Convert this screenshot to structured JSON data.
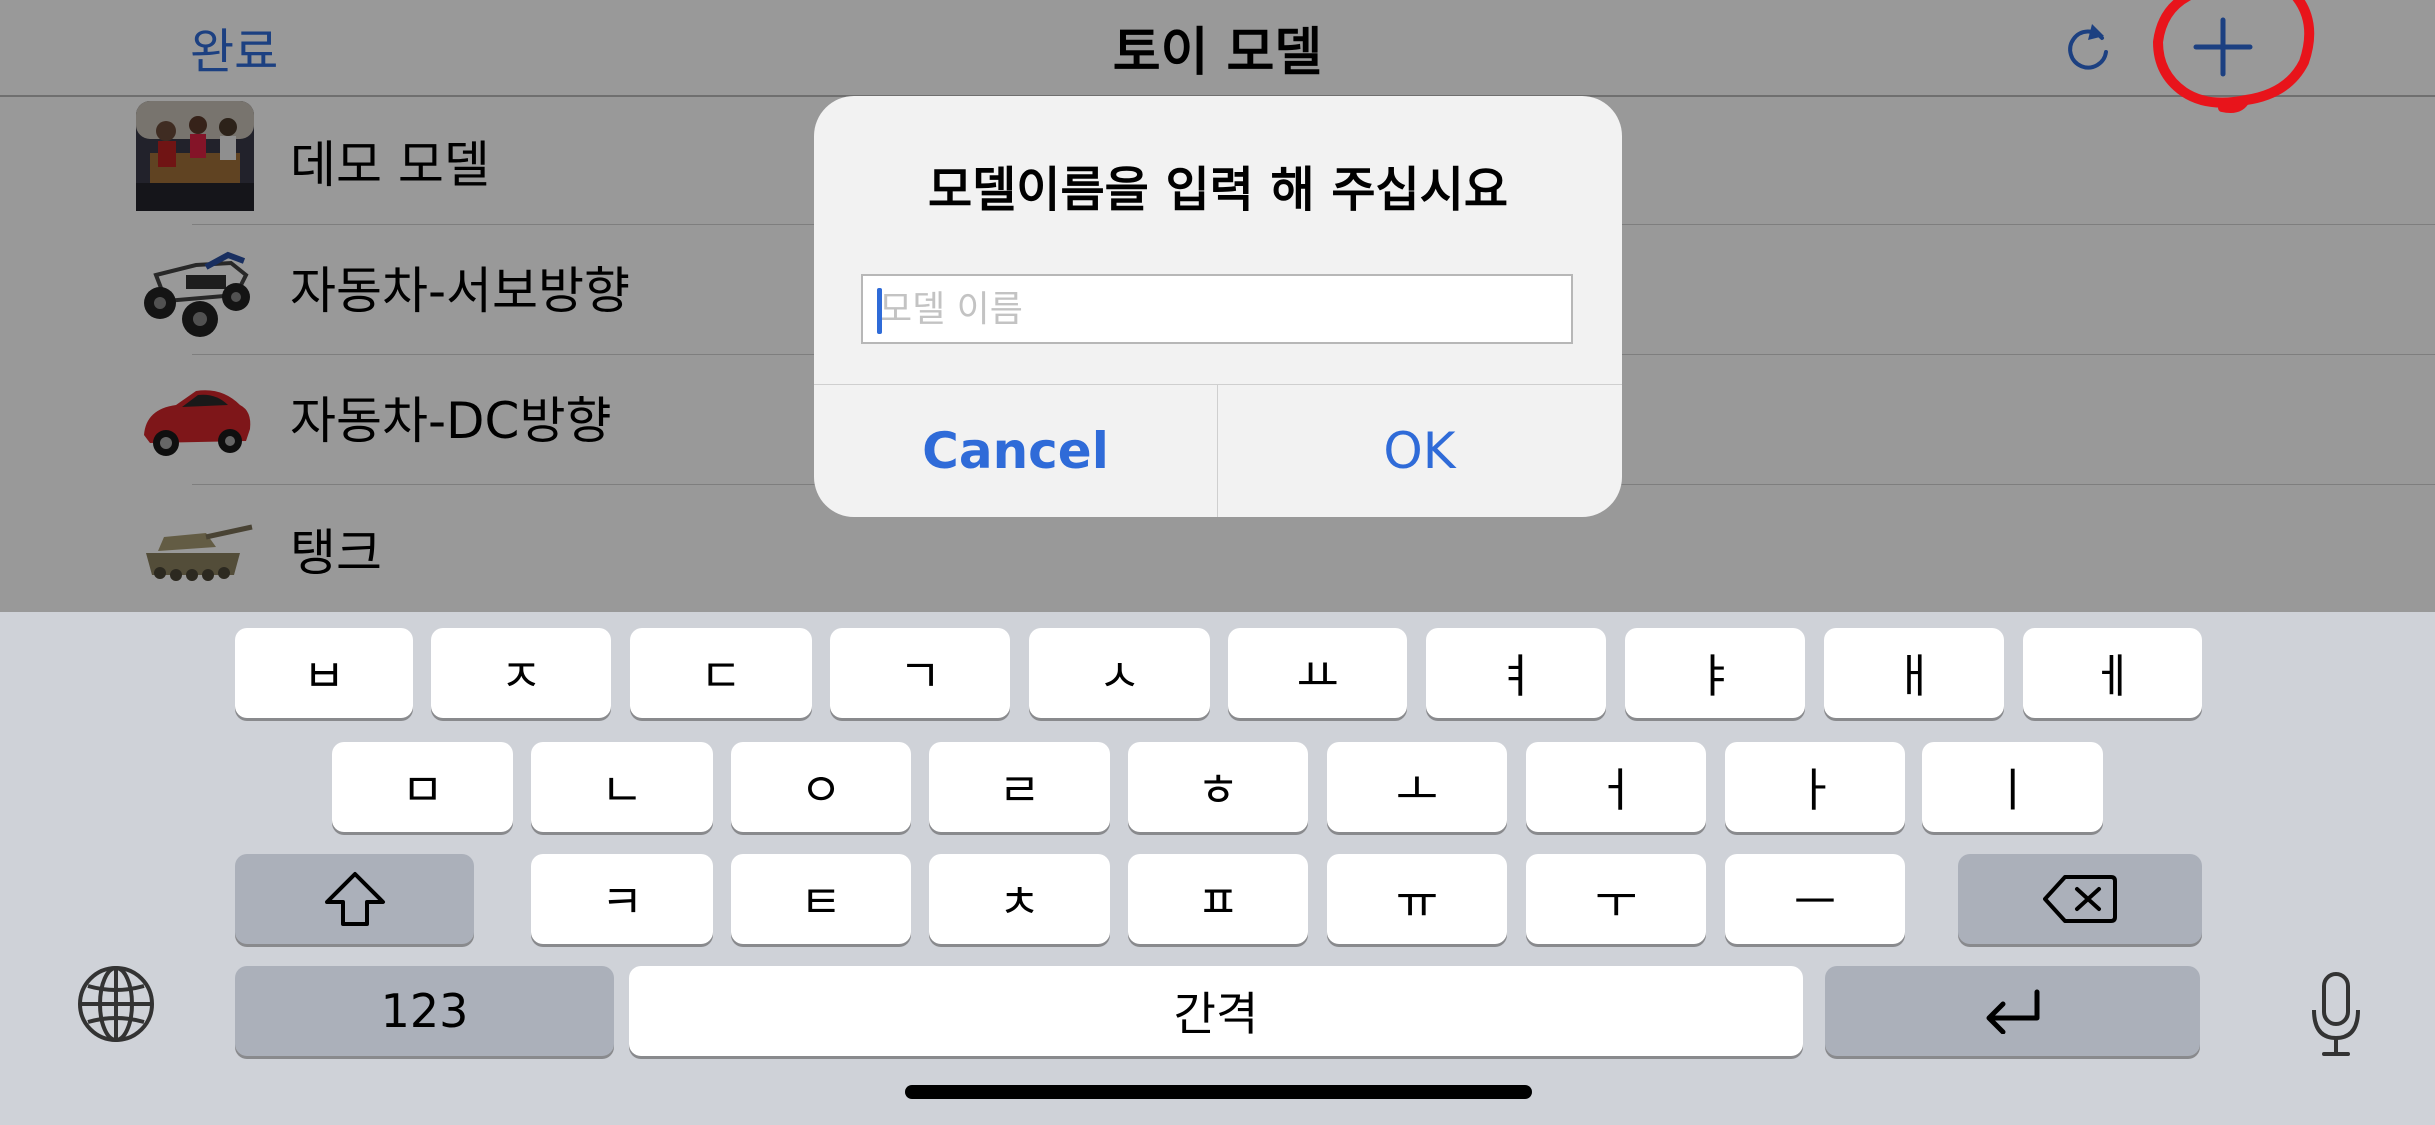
{
  "nav": {
    "done_label": "완료",
    "title": "토이 모델",
    "refresh_icon": "refresh-icon",
    "add_icon": "plus-icon",
    "accent": "#2f6bd8",
    "annotation_color": "#e8141b"
  },
  "models": [
    {
      "label": "데모 모델",
      "icon": "photo-thumbnail"
    },
    {
      "label": "자동차-서보방향",
      "icon": "buggy-thumbnail"
    },
    {
      "label": "자동차-DC방향",
      "icon": "red-car-thumbnail"
    },
    {
      "label": "탱크",
      "icon": "tank-thumbnail"
    }
  ],
  "alert": {
    "title": "모델이름을 입력 해 주십시요",
    "placeholder": "모델 이름",
    "value": "",
    "cancel_label": "Cancel",
    "ok_label": "OK"
  },
  "keyboard": {
    "row1": [
      "ㅂ",
      "ㅈ",
      "ㄷ",
      "ㄱ",
      "ㅅ",
      "ㅛ",
      "ㅕ",
      "ㅑ",
      "ㅐ",
      "ㅔ"
    ],
    "row2": [
      "ㅁ",
      "ㄴ",
      "ㅇ",
      "ㄹ",
      "ㅎ",
      "ㅗ",
      "ㅓ",
      "ㅏ",
      "ㅣ"
    ],
    "row3": [
      "ㅋ",
      "ㅌ",
      "ㅊ",
      "ㅍ",
      "ㅠ",
      "ㅜ",
      "ㅡ"
    ],
    "shift_icon": "shift-icon",
    "delete_icon": "delete-icon",
    "numbers_label": "123",
    "space_label": "간격",
    "return_icon": "return-icon",
    "globe_icon": "globe-icon",
    "mic_icon": "microphone-icon"
  }
}
